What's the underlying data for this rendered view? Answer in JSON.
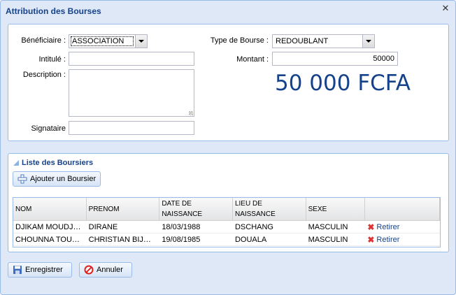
{
  "window": {
    "title": "Attribution des Bourses"
  },
  "form": {
    "beneficiaire": {
      "label": "Bénéficiaire :",
      "value": "ASSOCIATION"
    },
    "intitule": {
      "label": "Intitulé :",
      "value": ""
    },
    "description": {
      "label": "Description :",
      "value": ""
    },
    "signataire": {
      "label": "Signataire",
      "value": ""
    },
    "type_bourse": {
      "label": "Type de Bourse :",
      "value": "REDOUBLANT"
    },
    "montant": {
      "label": "Montant :",
      "value": "50000"
    },
    "montant_display": "50 000 FCFA"
  },
  "list": {
    "title": "Liste des Boursiers",
    "add_button": "Ajouter un Boursier",
    "columns": [
      "NOM",
      "PRENOM",
      "DATE DE NAISSANCE",
      "LIEU DE NAISSANCE",
      "SEXE",
      ""
    ],
    "rows": [
      {
        "nom": "DJIKAM MOUDJEU",
        "prenom": "DIRANE",
        "date": "18/03/1988",
        "lieu": "DSCHANG",
        "sexe": "MASCULIN",
        "action": "Retirer"
      },
      {
        "nom": "CHOUNNA TOUND...",
        "prenom": "CHRISTIAN BIJOTAT",
        "date": "19/08/1985",
        "lieu": "DOUALA",
        "sexe": "MASCULIN",
        "action": "Retirer"
      }
    ]
  },
  "footer": {
    "save_label": "Enregistrer",
    "cancel_label": "Annuler"
  },
  "icons": {
    "close": "close-icon",
    "save": "floppy-icon",
    "cancel": "cancel-icon",
    "add": "add-user-icon",
    "remove": "remove-icon"
  },
  "colors": {
    "title": "#15428b",
    "panel_border": "#99bbe8",
    "window_bg": "#dfe8f6"
  }
}
